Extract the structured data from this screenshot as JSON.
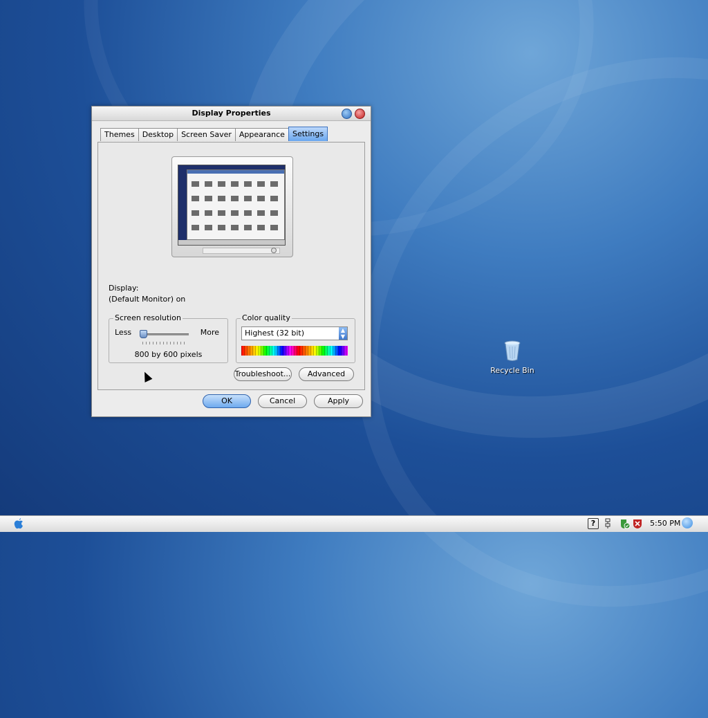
{
  "window": {
    "title": "Display Properties",
    "tabs": [
      {
        "label": "Themes"
      },
      {
        "label": "Desktop"
      },
      {
        "label": "Screen Saver"
      },
      {
        "label": "Appearance"
      },
      {
        "label": "Settings",
        "active": true
      }
    ],
    "display_label": "Display:",
    "display_value": "(Default Monitor) on",
    "screen_resolution": {
      "legend": "Screen resolution",
      "less": "Less",
      "more": "More",
      "value": "800 by 600 pixels"
    },
    "color_quality": {
      "legend": "Color quality",
      "selected": "Highest (32 bit)"
    },
    "troubleshoot_label": "Troubleshoot...",
    "advanced_label": "Advanced",
    "ok_label": "OK",
    "cancel_label": "Cancel",
    "apply_label": "Apply"
  },
  "desktop": {
    "recycle_bin_label": "Recycle Bin"
  },
  "taskbar": {
    "clock": "5:50 PM",
    "help_glyph": "?"
  },
  "colors": {
    "desktop_blue": "#1d4f98",
    "accent_blue": "#6aa6ee",
    "close_red": "#c21f1f"
  }
}
